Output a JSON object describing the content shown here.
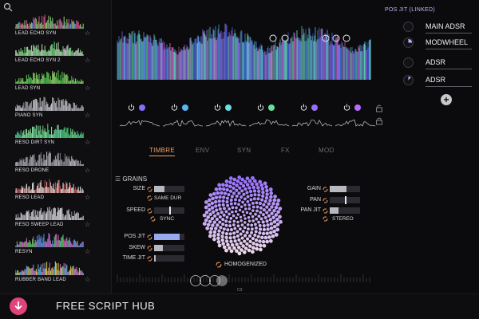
{
  "sidebar": {
    "presets": [
      {
        "label": "LEAD ECHO SYN",
        "colors": [
          "#e05a8a",
          "#9adf7a",
          "#5ab0f0"
        ]
      },
      {
        "label": "LEAD ECHO SYN 2",
        "colors": [
          "#7fe08a",
          "#e0e0e0",
          "#a0f0a0"
        ]
      },
      {
        "label": "LEAD SYN",
        "colors": [
          "#6fdc5a",
          "#b0f080",
          "#4ac050"
        ]
      },
      {
        "label": "PIANO SYN",
        "colors": [
          "#e8e8ec",
          "#c0c0c8",
          "#9a9aa2"
        ]
      },
      {
        "label": "RESO DIRT SYN",
        "colors": [
          "#5fe07a",
          "#a0ffb0",
          "#4ad0a0"
        ]
      },
      {
        "label": "RESO DRONE",
        "colors": [
          "#b0b0b8",
          "#808088",
          "#d0d0d8"
        ]
      },
      {
        "label": "RESO LEAD",
        "colors": [
          "#e05050",
          "#f0c0c0",
          "#ffffff"
        ]
      },
      {
        "label": "RESO SWEEP LEAD",
        "colors": [
          "#f0f0f4",
          "#d0d0d8",
          "#9a9aa2"
        ]
      },
      {
        "label": "RESYN",
        "colors": [
          "#6be06a",
          "#60a0f0",
          "#e070d0"
        ]
      },
      {
        "label": "RUBBER BAND LEAD",
        "colors": [
          "#f0e060",
          "#60c0f0",
          "#e080c0"
        ]
      }
    ]
  },
  "right_panel": {
    "title": "POS JIT (LINKED)",
    "items": [
      {
        "label": "MAIN ADSR"
      },
      {
        "label": "MODWHEEL"
      },
      {
        "label": "ADSR"
      },
      {
        "label": "ADSR"
      }
    ],
    "add_label": "+"
  },
  "grain_strips": [
    {
      "color": "#8a6cff"
    },
    {
      "color": "#5ab6f0"
    },
    {
      "color": "#6ae0e0"
    },
    {
      "color": "#6ae0a0"
    },
    {
      "color": "#9a6cff"
    },
    {
      "color": "#b86cff"
    }
  ],
  "tabs": [
    "TIMBRE",
    "ENV",
    "SYN",
    "FX",
    "MOD"
  ],
  "active_tab": "TIMBRE",
  "grains": {
    "header": "GRAINS",
    "size_label": "SIZE",
    "same_dur_label": "SAME DUR",
    "speed_label": "SPEED",
    "sync_label": "SYNC",
    "pos_jit_label": "POS JIT",
    "skew_label": "SKEW",
    "time_jit_label": "TIME JIT",
    "gain_label": "GAIN",
    "pan_label": "PAN",
    "pan_jit_label": "PAN JIT",
    "stereo_label": "STEREO",
    "homogenized_label": "HOMOGENIZED",
    "size_value": 0.35,
    "speed_value": 0.5,
    "pos_jit_value": 0.85,
    "skew_value": 0.3,
    "time_jit_value": 0.05,
    "gain_value": 0.55,
    "pan_value": 0.5,
    "pan_jit_value": 0.3
  },
  "ruler_label": "C3",
  "footer": {
    "text": "FREE SCRIPT HUB"
  },
  "colors": {
    "accent_orange": "#f0a060",
    "accent_purple": "#b8b8ff",
    "footer_pink": "#e0447a"
  }
}
